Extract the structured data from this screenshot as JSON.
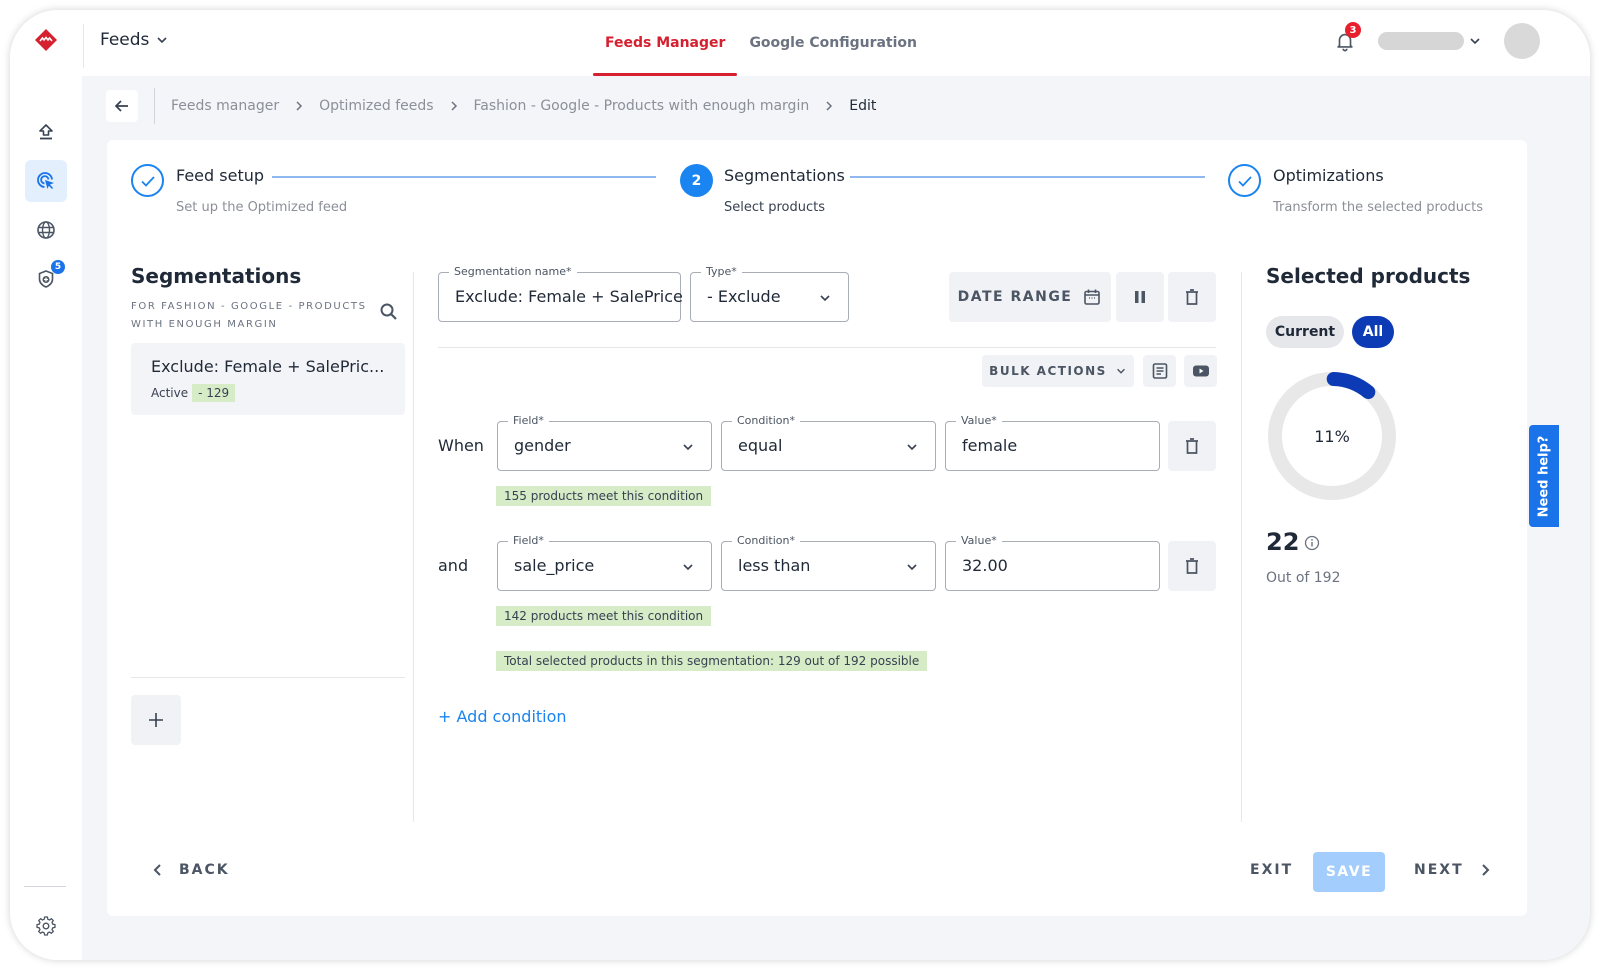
{
  "topbar": {
    "app_name": "Feeds",
    "tabs": [
      {
        "label": "Feeds Manager",
        "active": true
      },
      {
        "label": "Google Configuration",
        "active": false
      }
    ],
    "notification_count": "3",
    "brand_color": "#d5212f"
  },
  "rail": {
    "items": [
      {
        "icon": "upload-icon",
        "active": false
      },
      {
        "icon": "target-cursor-icon",
        "active": true
      },
      {
        "icon": "globe-icon",
        "active": false
      },
      {
        "icon": "shield-plus-icon",
        "active": false,
        "badge": "5"
      }
    ],
    "settings_icon": "gear-icon"
  },
  "breadcrumb": {
    "items": [
      "Feeds manager",
      "Optimized feeds",
      "Fashion - Google - Products with enough margin"
    ],
    "current": "Edit"
  },
  "stepper": {
    "steps": [
      {
        "title": "Feed setup",
        "subtitle": "Set up the Optimized feed",
        "state": "done"
      },
      {
        "title": "Segmentations",
        "subtitle": "Select products",
        "state": "active",
        "number": "2"
      },
      {
        "title": "Optimizations",
        "subtitle": "Transform the selected products",
        "state": "done"
      }
    ]
  },
  "segments_panel": {
    "title": "Segmentations",
    "subtitle": "FOR FASHION - GOOGLE - PRODUCTS WITH ENOUGH MARGIN",
    "items": [
      {
        "name": "Exclude: Female + SalePric...",
        "status": "Active",
        "count": "- 129"
      }
    ]
  },
  "editor": {
    "name_label": "Segmentation name*",
    "name_value": "Exclude: Female + SalePrice",
    "type_label": "Type*",
    "type_value": "- Exclude",
    "date_range_label": "DATE RANGE",
    "bulk_actions_label": "BULK ACTIONS",
    "conditions": [
      {
        "prefix": "When",
        "field_label": "Field*",
        "field": "gender",
        "condition_label": "Condition*",
        "condition": "equal",
        "value_label": "Value*",
        "value": "female",
        "match_text": "155 products meet this condition"
      },
      {
        "prefix": "and",
        "field_label": "Field*",
        "field": "sale_price",
        "condition_label": "Condition*",
        "condition": "less than",
        "value_label": "Value*",
        "value": "32.00",
        "match_text": "142 products meet this condition"
      }
    ],
    "total_text": "Total selected products in this segmentation: 129 out of 192 possible",
    "add_condition_label": "+ Add condition"
  },
  "selected": {
    "title": "Selected products",
    "toggle": [
      {
        "label": "Current",
        "active": false
      },
      {
        "label": "All",
        "active": true
      }
    ],
    "percent_label": "11%",
    "percent_value": 0.11,
    "count": "22",
    "out_of": "Out of 192",
    "accent_color": "#0d3bb5"
  },
  "footer": {
    "back_label": "BACK",
    "exit_label": "EXIT",
    "save_label": "SAVE",
    "next_label": "NEXT"
  },
  "help": {
    "label": "Need help?"
  }
}
